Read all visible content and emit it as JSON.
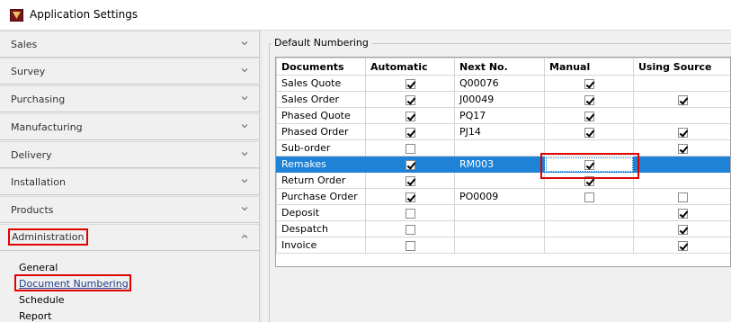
{
  "window": {
    "title": "Application Settings"
  },
  "sidebar": {
    "sections": [
      {
        "label": "Sales"
      },
      {
        "label": "Survey"
      },
      {
        "label": "Purchasing"
      },
      {
        "label": "Manufacturing"
      },
      {
        "label": "Delivery"
      },
      {
        "label": "Installation"
      },
      {
        "label": "Products"
      },
      {
        "label": "Administration"
      }
    ],
    "admin_links": [
      {
        "label": "General"
      },
      {
        "label": "Document Numbering"
      },
      {
        "label": "Schedule"
      },
      {
        "label": "Report"
      }
    ]
  },
  "numbering": {
    "group_label": "Default Numbering",
    "columns": [
      "Documents",
      "Automatic",
      "Next No.",
      "Manual",
      "Using Source"
    ],
    "rows": [
      {
        "doc": "Sales Quote",
        "automatic": true,
        "next": "Q00076",
        "manual": true,
        "source": null
      },
      {
        "doc": "Sales Order",
        "automatic": true,
        "next": "J00049",
        "manual": true,
        "source": true
      },
      {
        "doc": "Phased Quote",
        "automatic": true,
        "next": "PQ17",
        "manual": true,
        "source": null
      },
      {
        "doc": "Phased Order",
        "automatic": true,
        "next": "PJ14",
        "manual": true,
        "source": true
      },
      {
        "doc": "Sub-order",
        "automatic": false,
        "next": "",
        "manual": null,
        "source": true
      },
      {
        "doc": "Remakes",
        "automatic": true,
        "next": "RM003",
        "manual": true,
        "source": null
      },
      {
        "doc": "Return Order",
        "automatic": true,
        "next": "",
        "manual": true,
        "source": null
      },
      {
        "doc": "Purchase Order",
        "automatic": true,
        "next": "PO0009",
        "manual": false,
        "source": false
      },
      {
        "doc": "Deposit",
        "automatic": false,
        "next": "",
        "manual": null,
        "source": true
      },
      {
        "doc": "Despatch",
        "automatic": false,
        "next": "",
        "manual": null,
        "source": true
      },
      {
        "doc": "Invoice",
        "automatic": false,
        "next": "",
        "manual": null,
        "source": true
      }
    ],
    "selected_row": "Remakes"
  },
  "colors": {
    "selection": "#1e82d7",
    "highlight_box": "#e00000",
    "link": "#1f3c88"
  },
  "icons": {
    "chevron_collapsed": "chevron-down-icon",
    "chevron_expanded": "chevron-up-icon"
  }
}
